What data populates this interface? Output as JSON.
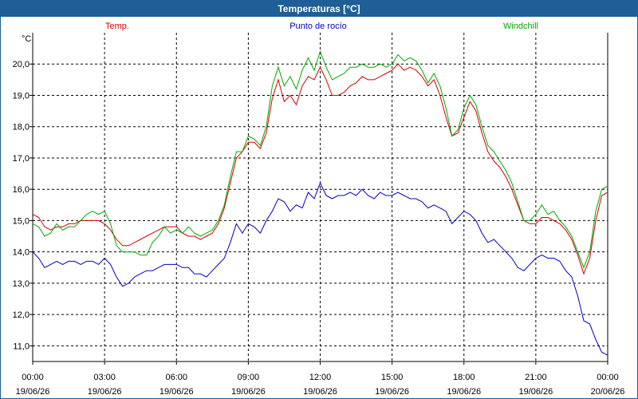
{
  "window": {
    "title": "Temperaturas [°C]"
  },
  "chart_data": {
    "type": "line",
    "title": "Temperaturas [°C]",
    "ylabel": "°C",
    "xlabel": "",
    "ylim": [
      10.5,
      21.0
    ],
    "xlim": [
      0,
      24
    ],
    "grid": true,
    "yticks": [
      11.0,
      12.0,
      13.0,
      14.0,
      15.0,
      16.0,
      17.0,
      18.0,
      19.0,
      20.0
    ],
    "ytick_labels": [
      "11,0",
      "12,0",
      "13,0",
      "14,0",
      "15,0",
      "16,0",
      "17,0",
      "18,0",
      "19,0",
      "20,0"
    ],
    "xticks": [
      0,
      3,
      6,
      9,
      12,
      15,
      18,
      21,
      24
    ],
    "xtick_labels": [
      {
        "time": "00:00",
        "date": "19/06/26"
      },
      {
        "time": "03:00",
        "date": "19/06/26"
      },
      {
        "time": "06:00",
        "date": "19/06/26"
      },
      {
        "time": "09:00",
        "date": "19/06/26"
      },
      {
        "time": "12:00",
        "date": "19/06/26"
      },
      {
        "time": "15:00",
        "date": "19/06/26"
      },
      {
        "time": "18:00",
        "date": "19/06/26"
      },
      {
        "time": "21:00",
        "date": "19/06/26"
      },
      {
        "time": "00:00",
        "date": "20/06/26"
      }
    ],
    "legend_placement": "top",
    "series": [
      {
        "name": "Temp.",
        "color": "#d40000",
        "points": [
          [
            0.0,
            15.2
          ],
          [
            0.25,
            15.1
          ],
          [
            0.5,
            14.8
          ],
          [
            0.75,
            14.7
          ],
          [
            1.0,
            14.8
          ],
          [
            1.25,
            14.8
          ],
          [
            1.5,
            14.9
          ],
          [
            1.75,
            14.9
          ],
          [
            2.0,
            15.0
          ],
          [
            2.25,
            15.0
          ],
          [
            2.5,
            15.0
          ],
          [
            2.75,
            15.0
          ],
          [
            3.0,
            14.9
          ],
          [
            3.25,
            14.7
          ],
          [
            3.5,
            14.4
          ],
          [
            3.75,
            14.2
          ],
          [
            4.0,
            14.2
          ],
          [
            4.25,
            14.3
          ],
          [
            4.5,
            14.4
          ],
          [
            4.75,
            14.5
          ],
          [
            5.0,
            14.6
          ],
          [
            5.25,
            14.7
          ],
          [
            5.5,
            14.8
          ],
          [
            5.75,
            14.8
          ],
          [
            6.0,
            14.8
          ],
          [
            6.25,
            14.6
          ],
          [
            6.5,
            14.5
          ],
          [
            6.75,
            14.5
          ],
          [
            7.0,
            14.4
          ],
          [
            7.25,
            14.5
          ],
          [
            7.5,
            14.6
          ],
          [
            7.75,
            14.9
          ],
          [
            8.0,
            15.4
          ],
          [
            8.25,
            16.2
          ],
          [
            8.5,
            17.0
          ],
          [
            8.75,
            17.2
          ],
          [
            9.0,
            17.5
          ],
          [
            9.25,
            17.5
          ],
          [
            9.5,
            17.3
          ],
          [
            9.75,
            17.8
          ],
          [
            10.0,
            18.9
          ],
          [
            10.25,
            19.5
          ],
          [
            10.5,
            18.8
          ],
          [
            10.75,
            19.0
          ],
          [
            11.0,
            18.7
          ],
          [
            11.25,
            19.3
          ],
          [
            11.5,
            19.6
          ],
          [
            11.75,
            19.5
          ],
          [
            12.0,
            19.9
          ],
          [
            12.25,
            19.5
          ],
          [
            12.5,
            19.0
          ],
          [
            12.75,
            19.0
          ],
          [
            13.0,
            19.1
          ],
          [
            13.25,
            19.3
          ],
          [
            13.5,
            19.4
          ],
          [
            13.75,
            19.6
          ],
          [
            14.0,
            19.5
          ],
          [
            14.25,
            19.5
          ],
          [
            14.5,
            19.6
          ],
          [
            14.75,
            19.7
          ],
          [
            15.0,
            19.8
          ],
          [
            15.25,
            20.0
          ],
          [
            15.5,
            19.8
          ],
          [
            15.75,
            19.9
          ],
          [
            16.0,
            19.8
          ],
          [
            16.25,
            19.6
          ],
          [
            16.5,
            19.3
          ],
          [
            16.75,
            19.5
          ],
          [
            17.0,
            19.0
          ],
          [
            17.25,
            18.3
          ],
          [
            17.5,
            17.7
          ],
          [
            17.75,
            17.8
          ],
          [
            18.0,
            18.3
          ],
          [
            18.25,
            18.8
          ],
          [
            18.5,
            18.5
          ],
          [
            18.75,
            17.8
          ],
          [
            19.0,
            17.2
          ],
          [
            19.25,
            16.9
          ],
          [
            19.5,
            16.7
          ],
          [
            19.75,
            16.4
          ],
          [
            20.0,
            16.0
          ],
          [
            20.25,
            15.5
          ],
          [
            20.5,
            15.0
          ],
          [
            20.75,
            14.9
          ],
          [
            21.0,
            14.9
          ],
          [
            21.25,
            15.1
          ],
          [
            21.5,
            15.1
          ],
          [
            21.75,
            15.0
          ],
          [
            22.0,
            14.9
          ],
          [
            22.25,
            14.7
          ],
          [
            22.5,
            14.4
          ],
          [
            22.75,
            13.9
          ],
          [
            23.0,
            13.3
          ],
          [
            23.25,
            13.8
          ],
          [
            23.5,
            15.0
          ],
          [
            23.75,
            15.8
          ],
          [
            24.0,
            15.9
          ]
        ]
      },
      {
        "name": "Punto de rocío",
        "color": "#0000c8",
        "points": [
          [
            0.0,
            14.0
          ],
          [
            0.25,
            13.8
          ],
          [
            0.5,
            13.5
          ],
          [
            0.75,
            13.6
          ],
          [
            1.0,
            13.7
          ],
          [
            1.25,
            13.6
          ],
          [
            1.5,
            13.7
          ],
          [
            1.75,
            13.7
          ],
          [
            2.0,
            13.6
          ],
          [
            2.25,
            13.7
          ],
          [
            2.5,
            13.7
          ],
          [
            2.75,
            13.6
          ],
          [
            3.0,
            13.8
          ],
          [
            3.25,
            13.6
          ],
          [
            3.5,
            13.2
          ],
          [
            3.75,
            12.9
          ],
          [
            4.0,
            13.0
          ],
          [
            4.25,
            13.2
          ],
          [
            4.5,
            13.3
          ],
          [
            4.75,
            13.4
          ],
          [
            5.0,
            13.4
          ],
          [
            5.25,
            13.5
          ],
          [
            5.5,
            13.6
          ],
          [
            5.75,
            13.6
          ],
          [
            6.0,
            13.6
          ],
          [
            6.25,
            13.5
          ],
          [
            6.5,
            13.5
          ],
          [
            6.75,
            13.3
          ],
          [
            7.0,
            13.3
          ],
          [
            7.25,
            13.2
          ],
          [
            7.5,
            13.4
          ],
          [
            7.75,
            13.6
          ],
          [
            8.0,
            13.8
          ],
          [
            8.25,
            14.3
          ],
          [
            8.5,
            14.9
          ],
          [
            8.75,
            14.6
          ],
          [
            9.0,
            14.9
          ],
          [
            9.25,
            14.8
          ],
          [
            9.5,
            14.6
          ],
          [
            9.75,
            15.0
          ],
          [
            10.0,
            15.3
          ],
          [
            10.25,
            15.7
          ],
          [
            10.5,
            15.6
          ],
          [
            10.75,
            15.3
          ],
          [
            11.0,
            15.5
          ],
          [
            11.25,
            15.4
          ],
          [
            11.5,
            15.9
          ],
          [
            11.75,
            15.7
          ],
          [
            12.0,
            16.2
          ],
          [
            12.25,
            15.8
          ],
          [
            12.5,
            15.7
          ],
          [
            12.75,
            15.8
          ],
          [
            13.0,
            15.8
          ],
          [
            13.25,
            15.9
          ],
          [
            13.5,
            15.8
          ],
          [
            13.75,
            16.0
          ],
          [
            14.0,
            15.8
          ],
          [
            14.25,
            15.7
          ],
          [
            14.5,
            15.9
          ],
          [
            14.75,
            15.8
          ],
          [
            15.0,
            15.8
          ],
          [
            15.25,
            15.9
          ],
          [
            15.5,
            15.8
          ],
          [
            15.75,
            15.7
          ],
          [
            16.0,
            15.7
          ],
          [
            16.25,
            15.6
          ],
          [
            16.5,
            15.4
          ],
          [
            16.75,
            15.5
          ],
          [
            17.0,
            15.4
          ],
          [
            17.25,
            15.3
          ],
          [
            17.5,
            14.9
          ],
          [
            17.75,
            15.1
          ],
          [
            18.0,
            15.3
          ],
          [
            18.25,
            15.2
          ],
          [
            18.5,
            15.0
          ],
          [
            18.75,
            14.6
          ],
          [
            19.0,
            14.3
          ],
          [
            19.25,
            14.4
          ],
          [
            19.5,
            14.2
          ],
          [
            19.75,
            14.0
          ],
          [
            20.0,
            13.8
          ],
          [
            20.25,
            13.5
          ],
          [
            20.5,
            13.4
          ],
          [
            20.75,
            13.6
          ],
          [
            21.0,
            13.8
          ],
          [
            21.25,
            13.9
          ],
          [
            21.5,
            13.8
          ],
          [
            21.75,
            13.8
          ],
          [
            22.0,
            13.7
          ],
          [
            22.25,
            13.4
          ],
          [
            22.5,
            13.2
          ],
          [
            22.75,
            12.6
          ],
          [
            23.0,
            11.8
          ],
          [
            23.25,
            11.7
          ],
          [
            23.5,
            11.2
          ],
          [
            23.75,
            10.8
          ],
          [
            24.0,
            10.7
          ]
        ]
      },
      {
        "name": "Windchill",
        "color": "#00aa00",
        "points": [
          [
            0.0,
            14.9
          ],
          [
            0.25,
            14.8
          ],
          [
            0.5,
            14.5
          ],
          [
            0.75,
            14.6
          ],
          [
            1.0,
            14.9
          ],
          [
            1.25,
            14.7
          ],
          [
            1.5,
            14.8
          ],
          [
            1.75,
            14.8
          ],
          [
            2.0,
            15.0
          ],
          [
            2.25,
            15.2
          ],
          [
            2.5,
            15.3
          ],
          [
            2.75,
            15.2
          ],
          [
            3.0,
            15.3
          ],
          [
            3.25,
            14.9
          ],
          [
            3.5,
            14.2
          ],
          [
            3.75,
            14.0
          ],
          [
            4.0,
            14.0
          ],
          [
            4.25,
            14.0
          ],
          [
            4.5,
            13.9
          ],
          [
            4.75,
            13.9
          ],
          [
            5.0,
            14.3
          ],
          [
            5.25,
            14.5
          ],
          [
            5.5,
            14.8
          ],
          [
            5.75,
            14.6
          ],
          [
            6.0,
            14.7
          ],
          [
            6.25,
            14.6
          ],
          [
            6.5,
            14.8
          ],
          [
            6.75,
            14.6
          ],
          [
            7.0,
            14.5
          ],
          [
            7.25,
            14.6
          ],
          [
            7.5,
            14.7
          ],
          [
            7.75,
            15.0
          ],
          [
            8.0,
            15.5
          ],
          [
            8.25,
            16.4
          ],
          [
            8.5,
            17.2
          ],
          [
            8.75,
            17.2
          ],
          [
            9.0,
            17.7
          ],
          [
            9.25,
            17.6
          ],
          [
            9.5,
            17.4
          ],
          [
            9.75,
            18.0
          ],
          [
            10.0,
            19.3
          ],
          [
            10.25,
            19.9
          ],
          [
            10.5,
            19.3
          ],
          [
            10.75,
            19.6
          ],
          [
            11.0,
            19.2
          ],
          [
            11.25,
            19.8
          ],
          [
            11.5,
            20.2
          ],
          [
            11.75,
            19.8
          ],
          [
            12.0,
            20.4
          ],
          [
            12.25,
            19.9
          ],
          [
            12.5,
            19.5
          ],
          [
            12.75,
            19.6
          ],
          [
            13.0,
            19.7
          ],
          [
            13.25,
            19.9
          ],
          [
            13.5,
            19.9
          ],
          [
            13.75,
            20.0
          ],
          [
            14.0,
            19.9
          ],
          [
            14.25,
            19.9
          ],
          [
            14.5,
            20.0
          ],
          [
            14.75,
            19.9
          ],
          [
            15.0,
            20.0
          ],
          [
            15.25,
            20.3
          ],
          [
            15.5,
            20.1
          ],
          [
            15.75,
            20.2
          ],
          [
            16.0,
            20.1
          ],
          [
            16.25,
            19.8
          ],
          [
            16.5,
            19.4
          ],
          [
            16.75,
            19.7
          ],
          [
            17.0,
            19.3
          ],
          [
            17.25,
            18.6
          ],
          [
            17.5,
            17.7
          ],
          [
            17.75,
            17.9
          ],
          [
            18.0,
            18.6
          ],
          [
            18.25,
            19.0
          ],
          [
            18.5,
            18.7
          ],
          [
            18.75,
            18.0
          ],
          [
            19.0,
            17.4
          ],
          [
            19.25,
            17.2
          ],
          [
            19.5,
            16.9
          ],
          [
            19.75,
            16.6
          ],
          [
            20.0,
            16.2
          ],
          [
            20.25,
            15.6
          ],
          [
            20.5,
            15.0
          ],
          [
            20.75,
            15.0
          ],
          [
            21.0,
            15.2
          ],
          [
            21.25,
            15.5
          ],
          [
            21.5,
            15.2
          ],
          [
            21.75,
            15.3
          ],
          [
            22.0,
            15.0
          ],
          [
            22.25,
            14.8
          ],
          [
            22.5,
            14.5
          ],
          [
            22.75,
            14.0
          ],
          [
            23.0,
            13.5
          ],
          [
            23.25,
            14.0
          ],
          [
            23.5,
            15.3
          ],
          [
            23.75,
            16.0
          ],
          [
            24.0,
            16.1
          ]
        ]
      }
    ]
  }
}
